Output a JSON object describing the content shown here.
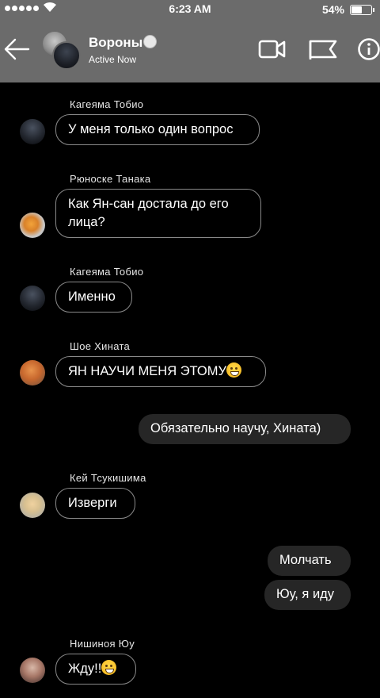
{
  "status_bar": {
    "time": "6:23 AM",
    "battery_percent": "54%",
    "battery_level": 0.54
  },
  "header": {
    "title": "Вороны",
    "status": "Active Now",
    "icons": [
      "back-arrow-icon",
      "video-call-icon",
      "flag-icon",
      "info-icon"
    ]
  },
  "messages": [
    {
      "sender": "Кагеяма Тобио",
      "text": "У меня только один вопрос"
    },
    {
      "sender": "Рюноске Танака",
      "text": "Как Ян-сан достала до его лица?"
    },
    {
      "sender": "Кагеяма Тобио",
      "text": "Именно"
    },
    {
      "sender": "Шое Хината",
      "text": "ЯН НАУЧИ МЕНЯ ЭТОМУ"
    },
    {
      "sender": "",
      "text": "Обязательно научу, Хината)"
    },
    {
      "sender": "Кей Тсукишима",
      "text": "Изверги"
    },
    {
      "sender": "",
      "text": "Молчать"
    },
    {
      "sender": "",
      "text": "Юу, я иду"
    },
    {
      "sender": "Нишиноя Юу",
      "text": "Жду!!"
    }
  ]
}
